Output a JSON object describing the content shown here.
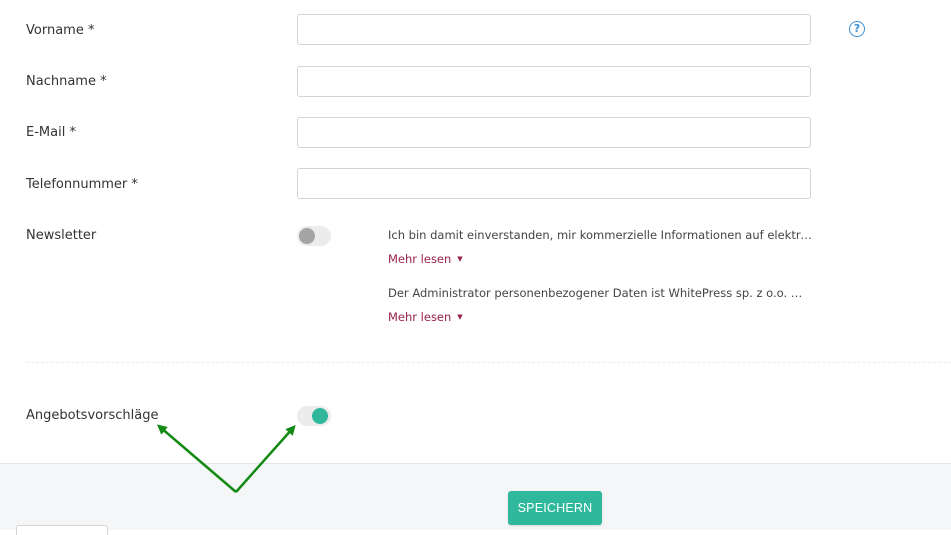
{
  "form": {
    "fields": [
      {
        "label": "Vorname *",
        "value": "",
        "placeholder": ""
      },
      {
        "label": "Nachname *",
        "value": "",
        "placeholder": ""
      },
      {
        "label": "E-Mail *",
        "value": "",
        "placeholder": ""
      },
      {
        "label": "Telefonnummer *",
        "value": "",
        "placeholder": ""
      }
    ],
    "help_icon_glyph": "?",
    "newsletter": {
      "label": "Newsletter",
      "enabled": false,
      "consents": [
        {
          "text": "Ich bin damit einverstanden, mir kommerzielle Informationen auf elektronisch...",
          "more_label": "Mehr lesen"
        },
        {
          "text": "Der Administrator personenbezogener Daten ist WhitePress sp. z o.o. mit Sitz i...",
          "more_label": "Mehr lesen"
        }
      ]
    },
    "offers": {
      "label": "Angebotsvorschläge",
      "enabled": true
    }
  },
  "footer": {
    "save_label": "SPEICHERN"
  },
  "colors": {
    "accent": "#2fb89c",
    "link": "#9a2149",
    "help": "#3a8fd6",
    "annotation_arrow": "#138a13"
  },
  "icons": {
    "help": "question-circle-icon",
    "caret": "caret-down-icon"
  }
}
